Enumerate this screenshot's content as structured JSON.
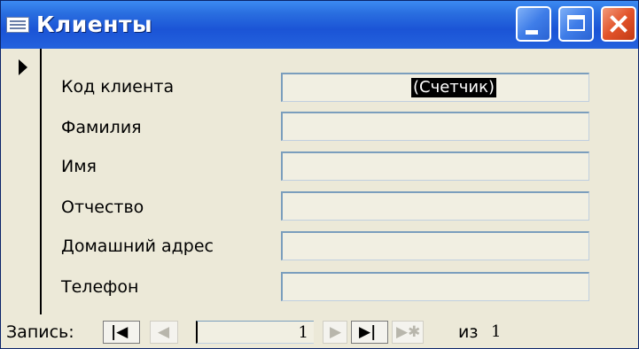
{
  "window": {
    "title": "Клиенты",
    "icon": "form-icon"
  },
  "titlebar_buttons": {
    "minimize": "minimize-icon",
    "maximize": "maximize-icon",
    "close": "close-icon"
  },
  "fields": [
    {
      "label": "Код клиента",
      "value": "(Счетчик)"
    },
    {
      "label": "Фамилия",
      "value": ""
    },
    {
      "label": "Имя",
      "value": ""
    },
    {
      "label": "Отчество",
      "value": ""
    },
    {
      "label": "Домашний адрес",
      "value": ""
    },
    {
      "label": "Телефон",
      "value": ""
    }
  ],
  "navigation": {
    "label": "Запись:",
    "current_record": "1",
    "of_label": "из",
    "total_records": "1",
    "buttons": [
      "first-record-icon",
      "previous-record-icon",
      "next-record-icon",
      "last-record-icon",
      "new-record-icon"
    ]
  }
}
